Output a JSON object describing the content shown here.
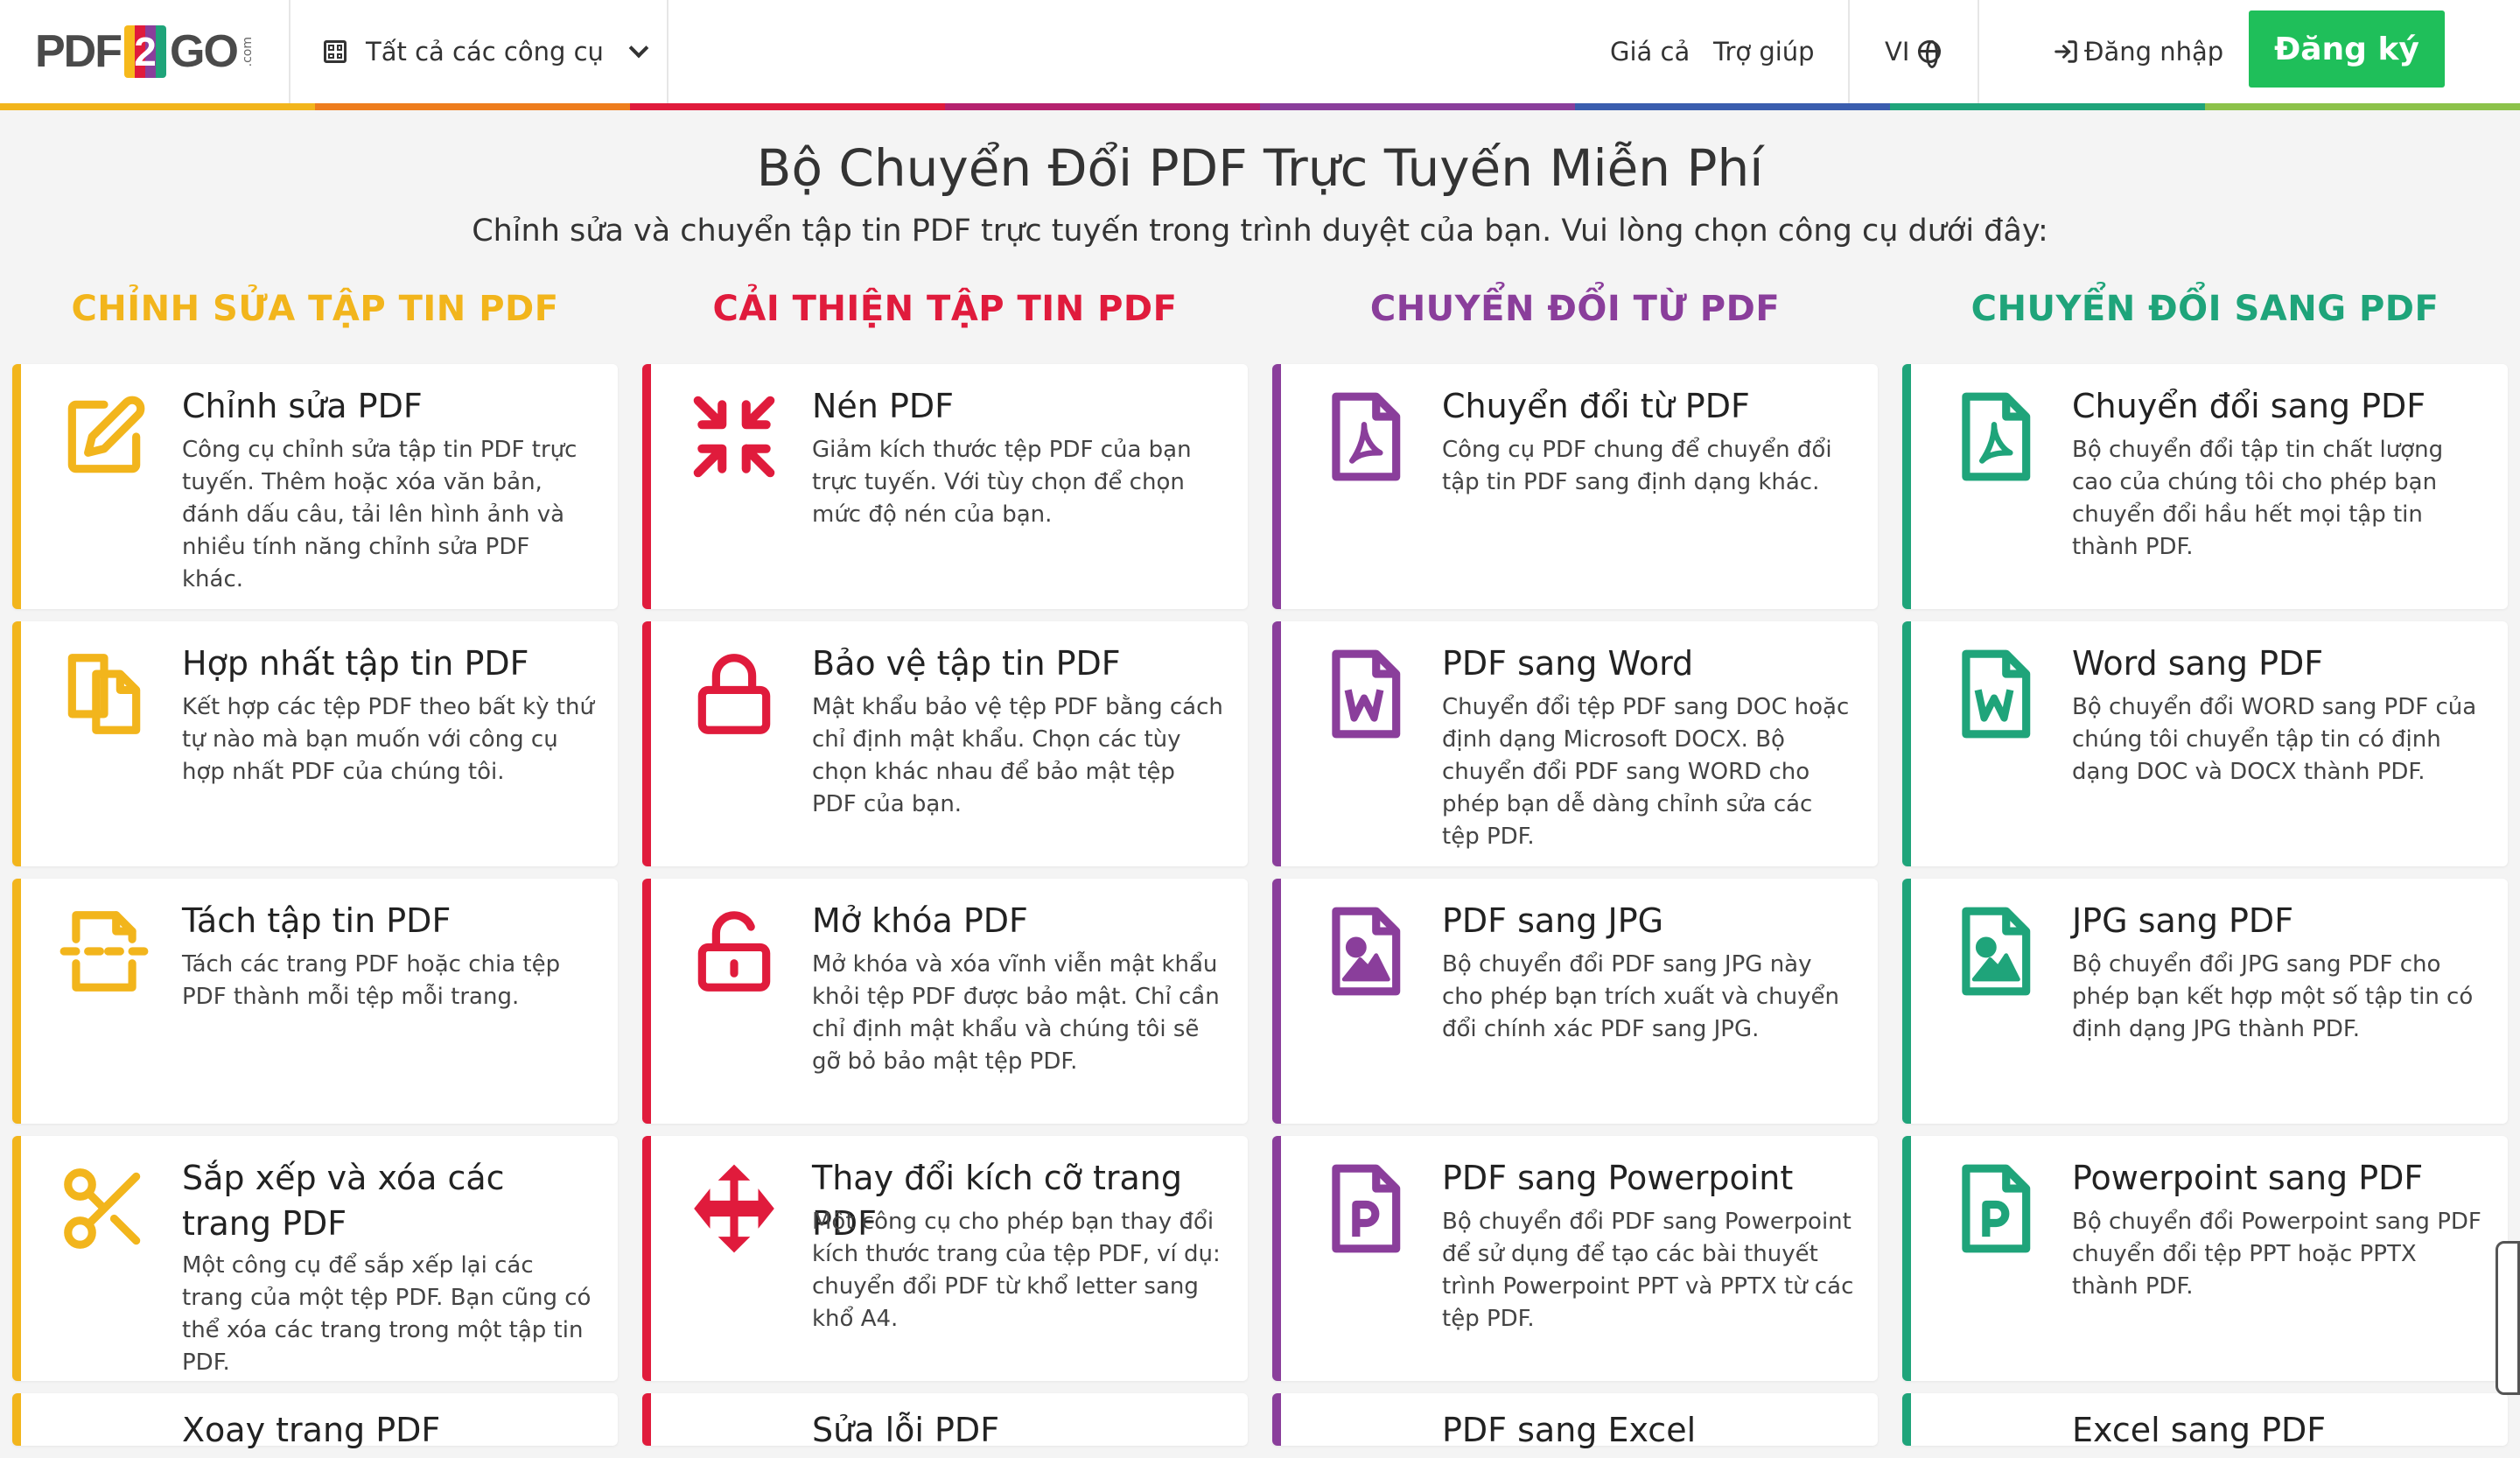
{
  "header": {
    "logo": {
      "left": "PDF",
      "two": "2",
      "right": "GO",
      "com": ".com"
    },
    "tools_label": "Tất cả các công cụ",
    "pricing": "Giá cả",
    "help": "Trợ giúp",
    "lang": "VI",
    "login": "Đăng nhập",
    "signup": "Đăng ký"
  },
  "colors": {
    "yellow": "#f2b51c",
    "red": "#e01b3c",
    "purple": "#8a3e9b",
    "green": "#1fa47a",
    "signup": "#1fbf5a"
  },
  "hero": {
    "title": "Bộ Chuyển Đổi PDF Trực Tuyến Miễn Phí",
    "subtitle": "Chỉnh sửa và chuyển tập tin PDF trực tuyến trong trình duyệt của bạn. Vui lòng chọn công cụ dưới đây:"
  },
  "columns": [
    {
      "title": "CHỈNH SỬA TẬP TIN PDF",
      "cards": [
        {
          "icon": "edit-icon",
          "title": "Chỉnh sửa PDF",
          "desc": "Công cụ chỉnh sửa tập tin PDF trực tuyến. Thêm hoặc xóa văn bản, đánh dấu câu, tải lên hình ảnh và nhiều tính năng chỉnh sửa PDF khác."
        },
        {
          "icon": "merge-icon",
          "title": "Hợp nhất tập tin PDF",
          "desc": "Kết hợp các tệp PDF theo bất kỳ thứ tự nào mà bạn muốn với công cụ hợp nhất PDF của chúng tôi."
        },
        {
          "icon": "split-icon",
          "title": "Tách tập tin PDF",
          "desc": "Tách các trang PDF hoặc chia tệp PDF thành mỗi tệp mỗi trang."
        },
        {
          "icon": "scissors-icon",
          "title": "Sắp xếp và xóa các trang PDF",
          "desc": "Một công cụ để sắp xếp lại các trang của một tệp PDF. Bạn cũng có thể xóa các trang trong một tập tin PDF."
        },
        {
          "title": "Xoay trang PDF"
        }
      ]
    },
    {
      "title": "CẢI THIỆN TẬP TIN PDF",
      "cards": [
        {
          "icon": "compress-icon",
          "title": "Nén PDF",
          "desc": "Giảm kích thước tệp PDF của bạn trực tuyến. Với tùy chọn để chọn mức độ nén của bạn."
        },
        {
          "icon": "lock-icon",
          "title": "Bảo vệ tập tin PDF",
          "desc": "Mật khẩu bảo vệ tệp PDF bằng cách chỉ định mật khẩu. Chọn các tùy chọn khác nhau để bảo mật tệp PDF của bạn."
        },
        {
          "icon": "unlock-icon",
          "title": "Mở khóa PDF",
          "desc": "Mở khóa và xóa vĩnh viễn mật khẩu khỏi tệp PDF được bảo mật. Chỉ cần chỉ định mật khẩu và chúng tôi sẽ gỡ bỏ bảo mật tệp PDF."
        },
        {
          "icon": "move-arrows-icon",
          "title": "Thay đổi kích cỡ trang PDF",
          "desc": "Một công cụ cho phép bạn thay đổi kích thước trang của tệp PDF, ví dụ: chuyển đổi PDF từ khổ letter sang khổ A4."
        },
        {
          "title": "Sửa lỗi PDF"
        }
      ]
    },
    {
      "title": "CHUYỂN ĐỔI TỪ PDF",
      "cards": [
        {
          "icon": "pdf-file-icon",
          "title": "Chuyển đổi từ PDF",
          "desc": "Công cụ PDF chung để chuyển đổi tập tin PDF sang định dạng khác."
        },
        {
          "icon": "word-file-icon",
          "title": "PDF sang Word",
          "desc": "Chuyển đổi tệp PDF sang DOC hoặc định dạng Microsoft DOCX. Bộ chuyển đổi PDF sang WORD cho phép bạn dễ dàng chỉnh sửa các tệp PDF."
        },
        {
          "icon": "image-file-icon",
          "title": "PDF sang JPG",
          "desc": "Bộ chuyển đổi PDF sang JPG này cho phép bạn trích xuất và chuyển đổi chính xác PDF sang JPG."
        },
        {
          "icon": "powerpoint-file-icon",
          "title": "PDF sang Powerpoint",
          "desc": "Bộ chuyển đổi PDF sang Powerpoint để sử dụng để tạo các bài thuyết trình Powerpoint PPT và PPTX từ các tệp PDF."
        },
        {
          "title": "PDF sang Excel"
        }
      ]
    },
    {
      "title": "CHUYỂN ĐỔI SANG PDF",
      "cards": [
        {
          "icon": "pdf-file-icon",
          "title": "Chuyển đổi sang PDF",
          "desc": "Bộ chuyển đổi tập tin chất lượng cao của chúng tôi cho phép bạn chuyển đổi hầu hết mọi tập tin thành PDF."
        },
        {
          "icon": "word-file-icon",
          "title": "Word sang PDF",
          "desc": "Bộ chuyển đổi WORD sang PDF của chúng tôi chuyển tập tin có định dạng DOC và DOCX thành PDF."
        },
        {
          "icon": "image-file-icon",
          "title": "JPG sang PDF",
          "desc": "Bộ chuyển đổi JPG sang PDF cho phép bạn kết hợp một số tập tin có định dạng JPG thành PDF."
        },
        {
          "icon": "powerpoint-file-icon",
          "title": "Powerpoint sang PDF",
          "desc": "Bộ chuyển đổi Powerpoint sang PDF chuyển đổi tệp PPT hoặc PPTX thành PDF."
        },
        {
          "title": "Excel sang PDF"
        }
      ]
    }
  ]
}
